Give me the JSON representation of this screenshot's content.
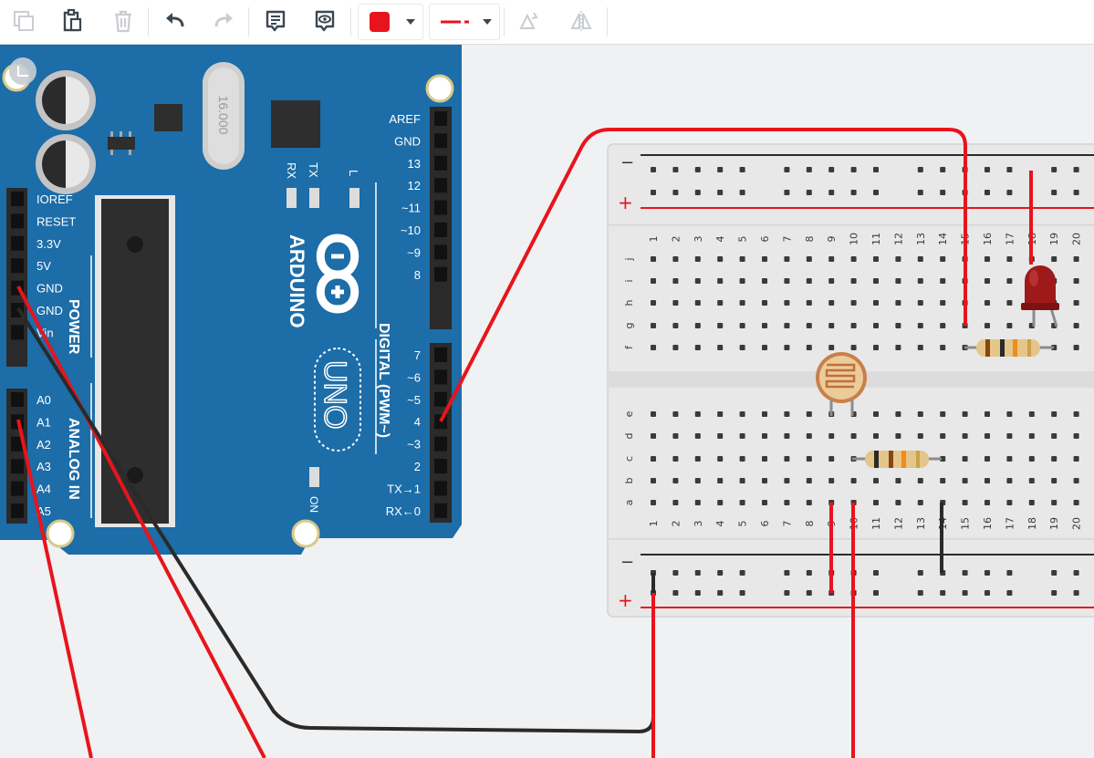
{
  "toolbar": {
    "buttons": [
      {
        "name": "copy-button",
        "icon": "copy-icon",
        "enabled": false
      },
      {
        "name": "paste-button",
        "icon": "clipboard-icon",
        "enabled": true
      },
      {
        "name": "delete-button",
        "icon": "trash-icon",
        "enabled": false
      },
      {
        "name": "undo-button",
        "icon": "undo-icon",
        "enabled": true
      },
      {
        "name": "redo-button",
        "icon": "redo-icon",
        "enabled": false
      },
      {
        "name": "note-button",
        "icon": "note-icon",
        "enabled": true
      },
      {
        "name": "view-button",
        "icon": "eye-icon",
        "enabled": true
      },
      {
        "name": "rotate-button",
        "icon": "rotate-icon",
        "enabled": false
      },
      {
        "name": "flip-button",
        "icon": "flip-icon",
        "enabled": false
      }
    ],
    "wire_color": "#e8141c",
    "wire_style_color": "#e8141c"
  },
  "arduino": {
    "brand": "ARDUINO",
    "model": "UNO",
    "crystal": "16.000",
    "power_label": "POWER",
    "analog_label": "ANALOG IN",
    "digital_label": "DIGITAL (PWM~)",
    "on_label": "ON",
    "rx_led": "RX",
    "tx_led": "TX",
    "l_led": "L",
    "power_pins": [
      "IOREF",
      "RESET",
      "3.3V",
      "5V",
      "GND",
      "GND",
      "Vin"
    ],
    "analog_pins": [
      "A0",
      "A1",
      "A2",
      "A3",
      "A4",
      "A5"
    ],
    "digital_pins_top": [
      "AREF",
      "GND",
      "13",
      "12",
      "~11",
      "~10",
      "~9",
      "8"
    ],
    "digital_pins_bottom": [
      "7",
      "~6",
      "~5",
      "4",
      "~3",
      "2",
      "TX→1",
      "RX←0"
    ],
    "board_color": "#1c6da8"
  },
  "breadboard": {
    "row_letters_top": [
      "j",
      "i",
      "h",
      "g",
      "f"
    ],
    "row_letters_bottom": [
      "e",
      "d",
      "c",
      "b",
      "a"
    ],
    "columns": [
      "1",
      "2",
      "3",
      "4",
      "5",
      "6",
      "7",
      "8",
      "9",
      "10",
      "11",
      "12",
      "13",
      "14",
      "15",
      "16",
      "17",
      "18",
      "19",
      "20"
    ],
    "rail_minus": "−",
    "rail_plus": "+"
  },
  "wire_colors": {
    "red": "#e8141c",
    "black": "#2a2a2a"
  }
}
